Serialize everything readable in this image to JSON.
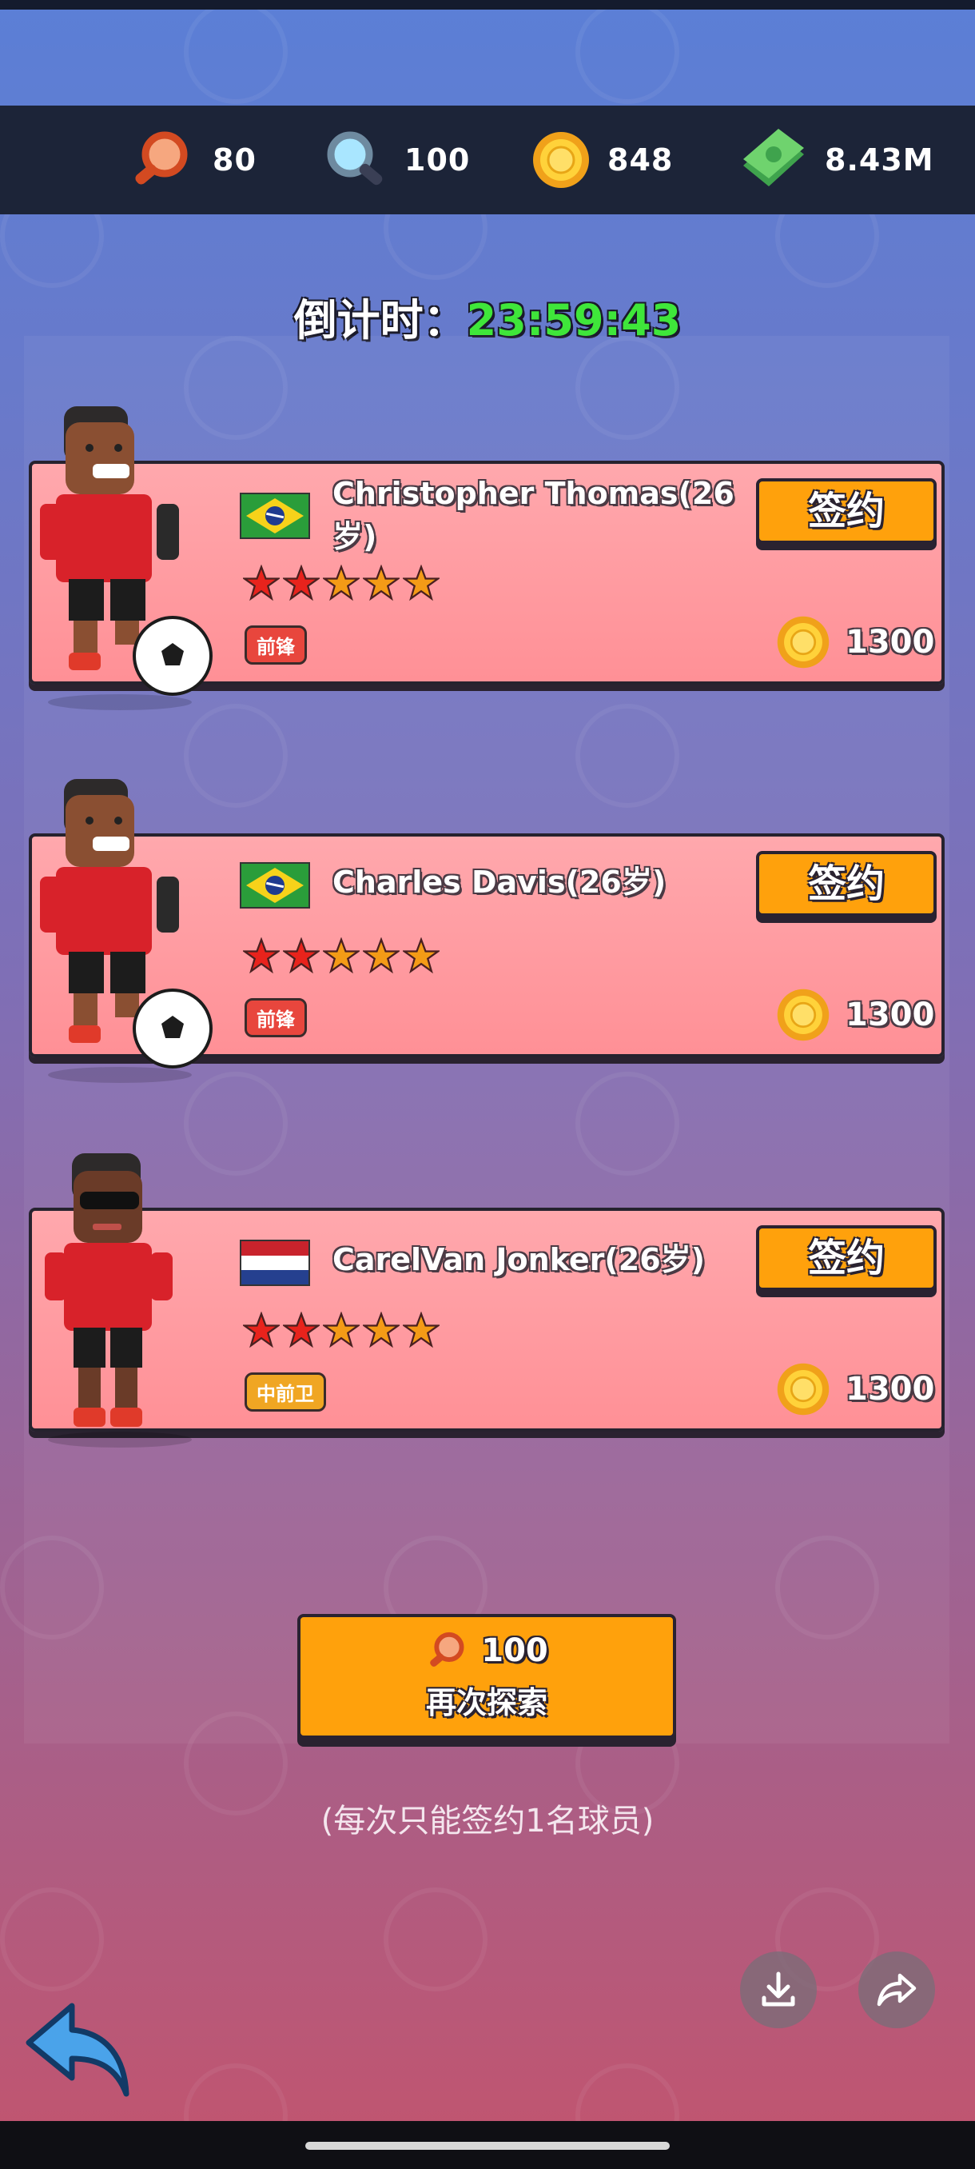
{
  "resources": [
    {
      "icon": "red-magnifier-icon",
      "value": "80"
    },
    {
      "icon": "blue-magnifier-icon",
      "value": "100"
    },
    {
      "icon": "gold-coin-icon",
      "value": "848"
    },
    {
      "icon": "cash-stack-icon",
      "value": "8.43M"
    }
  ],
  "countdown": {
    "label": "倒计时：",
    "time": "23:59:43"
  },
  "players": [
    {
      "name": "Christopher Thomas(26岁)",
      "flag": "brazil",
      "stars_filled": 2,
      "stars_total": 5,
      "position": "前锋",
      "sign_label": "签约",
      "price": "1300"
    },
    {
      "name": "Charles Davis(26岁)",
      "flag": "brazil",
      "stars_filled": 2,
      "stars_total": 5,
      "position": "前锋",
      "sign_label": "签约",
      "price": "1300"
    },
    {
      "name": "CarelVan Jonker(26岁)",
      "flag": "netherlands",
      "stars_filled": 2,
      "stars_total": 5,
      "position": "中前卫",
      "sign_label": "签约",
      "price": "1300"
    }
  ],
  "search_again": {
    "cost": "100",
    "label": "再次探索"
  },
  "note": "(每次只能签约1名球员)",
  "colors": {
    "accent_orange": "#ffa10c",
    "card_pink": "#ff9ea3",
    "timer_green": "#3fe63a",
    "star_red": "#e8231c",
    "star_orange": "#f49b16"
  }
}
